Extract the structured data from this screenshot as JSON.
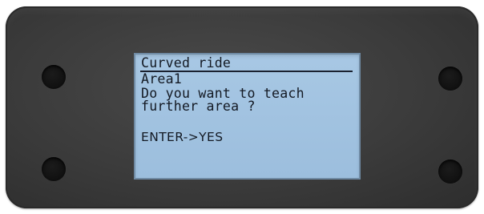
{
  "display": {
    "title": "Curved ride",
    "line1": "Area1",
    "line2": "Do you want to teach",
    "line3": "further area ?",
    "line4": "ENTER->YES"
  },
  "colors": {
    "bezel": "#3b3b3b",
    "screen": "#a2c3e1",
    "text": "#141a24"
  }
}
